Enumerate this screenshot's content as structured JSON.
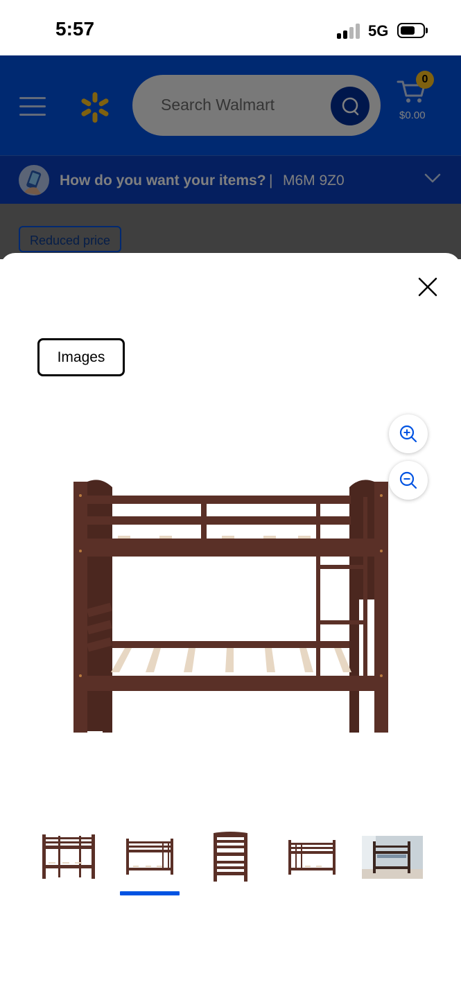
{
  "status_bar": {
    "time": "5:57",
    "network": "5G"
  },
  "header": {
    "search": {
      "placeholder": "Search Walmart"
    },
    "cart": {
      "count": "0",
      "total": "$0.00"
    },
    "colors": {
      "brand_blue": "#0053e2",
      "spark_yellow": "#ffc220"
    }
  },
  "delivery": {
    "prompt": "How do you want your items?",
    "separator": "|",
    "postal_code": "M6M 9Z0"
  },
  "underlay": {
    "badge": "Reduced price"
  },
  "modal": {
    "tab_label": "Images",
    "icons": [
      "close-icon",
      "zoom-in-icon",
      "zoom-out-icon"
    ],
    "thumbnails": [
      {
        "name": "bunk-bed-angled"
      },
      {
        "name": "bunk-bed-front",
        "selected": true
      },
      {
        "name": "bunk-bed-side"
      },
      {
        "name": "bunk-bed-front-small"
      },
      {
        "name": "bunk-bed-room-photo"
      }
    ],
    "selected_thumbnail_index": 1,
    "product_color": "#5a3027"
  }
}
